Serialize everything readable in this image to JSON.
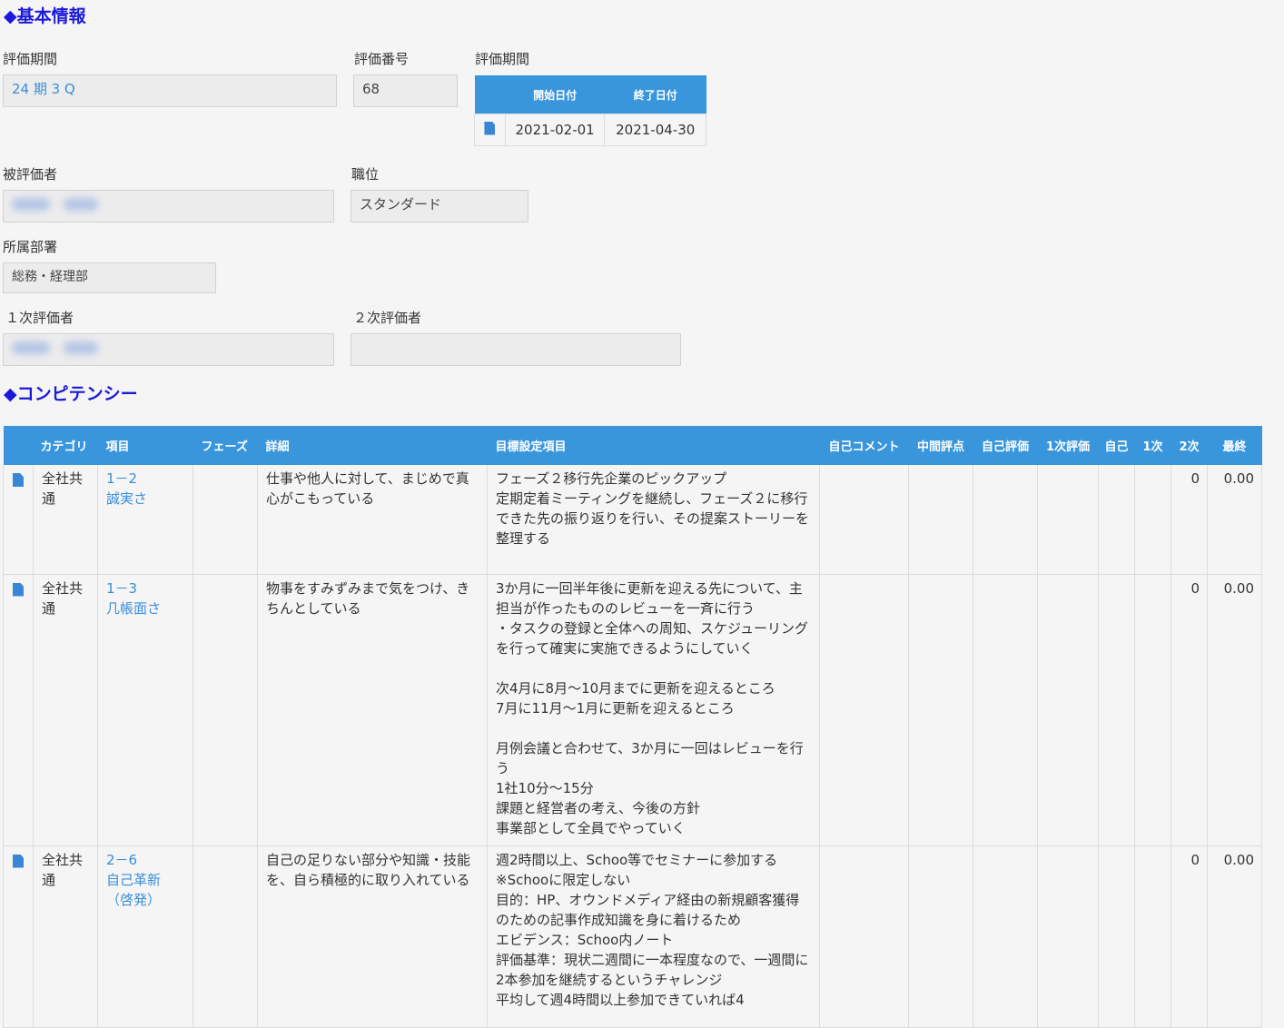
{
  "basic": {
    "title": "◆基本情報",
    "period_label": "評価期間",
    "period_value": "24 期 3 Q",
    "number_label": "評価番号",
    "number_value": "68",
    "duration_label": "評価期間",
    "start_header": "開始日付",
    "end_header": "終了日付",
    "start_date": "2021-02-01",
    "end_date": "2021-04-30",
    "evaluatee_label": "被評価者",
    "position_label": "職位",
    "position_value": "スタンダード",
    "dept_label": "所属部署",
    "dept_value": "総務・経理部",
    "first_eval_label": "１次評価者",
    "second_eval_label": "２次評価者",
    "second_eval_value": ""
  },
  "competency": {
    "title": "◆コンピテンシー",
    "headers": [
      "カテゴリ",
      "項目",
      "フェーズ",
      "詳細",
      "目標設定項目",
      "自己コメント",
      "中間評点",
      "自己評価",
      "1次評価",
      "自己",
      "1次",
      "2次",
      "最終"
    ],
    "rows": [
      {
        "category": "全社共通",
        "item_code": "1－2",
        "item_name": "誠実さ",
        "phase": "",
        "detail": "仕事や他人に対して、まじめで真心がこもっている",
        "goal": "フェーズ２移行先企業のピックアップ\n定期定着ミーティングを継続し、フェーズ２に移行できた先の振り返りを行い、その提案ストーリーを整理する",
        "score2": "0",
        "final": "0.00"
      },
      {
        "category": "全社共通",
        "item_code": "1－3",
        "item_name": "几帳面さ",
        "phase": "",
        "detail": "物事をすみずみまで気をつけ、きちんとしている",
        "goal": "3か月に一回半年後に更新を迎える先について、主担当が作ったもののレビューを一斉に行う\n・タスクの登録と全体への周知、スケジューリングを行って確実に実施できるようにしていく\n\n次4月に8月～10月までに更新を迎えるところ\n7月に11月～1月に更新を迎えるところ\n\n月例会議と合わせて、3か月に一回はレビューを行う\n1社10分～15分\n課題と経営者の考え、今後の方針\n事業部として全員でやっていく",
        "score2": "0",
        "final": "0.00"
      },
      {
        "category": "全社共通",
        "item_code": "2－6",
        "item_name": "自己革新（啓発）",
        "phase": "",
        "detail": "自己の足りない部分や知識・技能を、自ら積極的に取り入れている",
        "goal": "週2時間以上、Schoo等でセミナーに参加する\n※Schooに限定しない\n目的：HP、オウンドメディア経由の新規顧客獲得のための記事作成知識を身に着けるため\nエビデンス：Schoo内ノート\n評価基準：現状二週間に一本程度なので、一週間に2本参加を継続するというチャレンジ\n平均して週4時間以上参加できていれば4",
        "score2": "0",
        "final": "0.00"
      }
    ]
  },
  "colors": {
    "accent": "#3a96dc",
    "title": "#1a1adb",
    "link": "#3a8ed8"
  },
  "icons": {
    "row_icon": "document-icon"
  }
}
